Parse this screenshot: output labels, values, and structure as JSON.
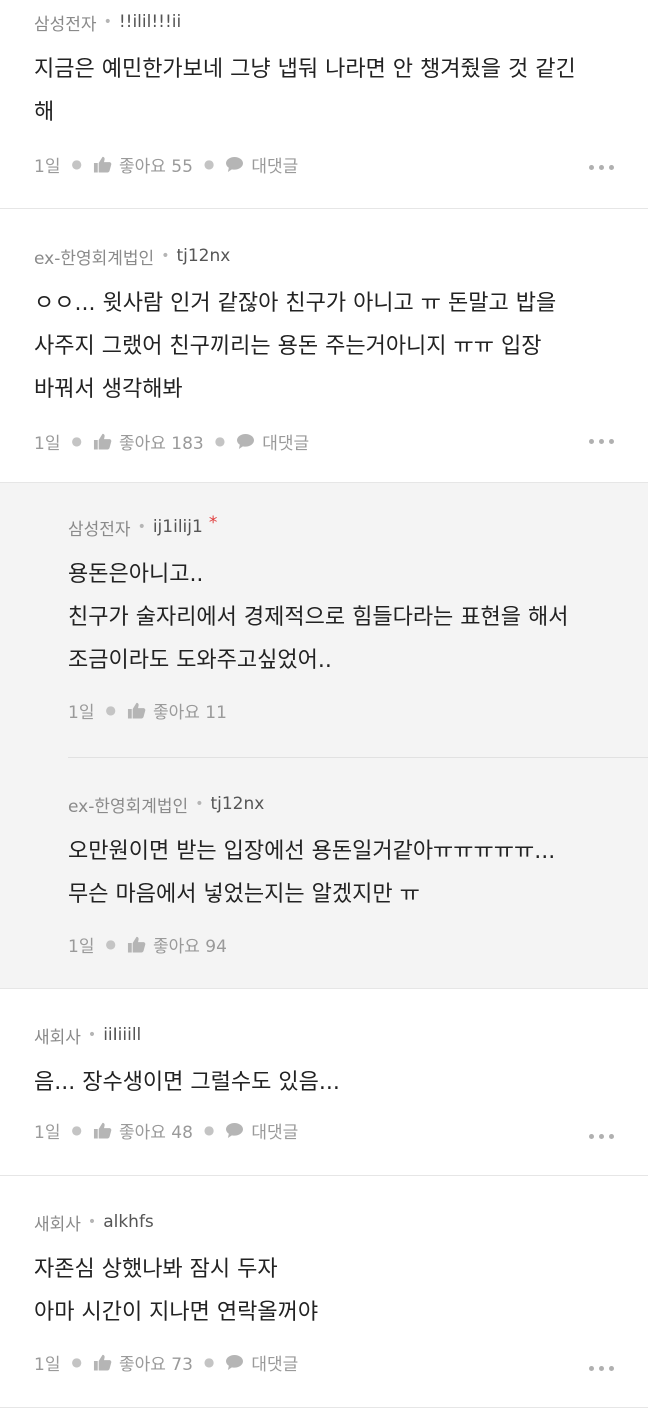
{
  "comments": [
    {
      "company": "삼성전자",
      "nickname": "!!ilil!!!ii",
      "lines": [
        "지금은 예민한가보네 그냥 냅둬 나라면 안 챙겨줬을 것 같긴",
        "해"
      ],
      "time": "1일",
      "like_label": "좋아요 55",
      "reply_label": "대댓글"
    },
    {
      "company": "ex-한영회계법인",
      "nickname": "tj12nx",
      "lines": [
        "ㅇㅇ... 윗사람 인거 같잖아 친구가 아니고 ㅠ 돈말고 밥을",
        "사주지 그랬어 친구끼리는 용돈 주는거아니지  ㅠㅠ  입장",
        "바꿔서 생각해봐"
      ],
      "time": "1일",
      "like_label": "좋아요 183",
      "reply_label": "대댓글"
    },
    {
      "company": "새회사",
      "nickname": "iiIiiill",
      "lines": [
        "음... 장수생이면 그럴수도 있음..."
      ],
      "time": "1일",
      "like_label": "좋아요 48",
      "reply_label": "대댓글"
    },
    {
      "company": "새회사",
      "nickname": "alkhfs",
      "lines": [
        "자존심 상했나봐 잠시 두자",
        "아마 시간이 지나면 연락올꺼야"
      ],
      "time": "1일",
      "like_label": "좋아요 73",
      "reply_label": "대댓글"
    }
  ],
  "replies": [
    {
      "company": "삼성전자",
      "nickname": "ij1ilij1",
      "author_mark": "*",
      "lines": [
        "용돈은아니고..",
        "친구가 술자리에서 경제적으로 힘들다라는 표현을 해서",
        "조금이라도 도와주고싶었어.."
      ],
      "time": "1일",
      "like_label": "좋아요 11"
    },
    {
      "company": "ex-한영회계법인",
      "nickname": "tj12nx",
      "lines": [
        "오만원이면 받는 입장에선 용돈일거같아ㅠㅠㅠㅠㅠ...",
        "무슨 마음에서 넣었는지는 알겠지만 ㅠ"
      ],
      "time": "1일",
      "like_label": "좋아요 94"
    }
  ],
  "icons": {
    "like": "thumbs-up-icon",
    "reply": "speech-bubble-icon",
    "more": "more-dots-icon"
  },
  "colors": {
    "meta": "#8a8a8a",
    "accent_mark": "#e03b3b",
    "reply_bg": "#f4f4f4",
    "divider": "#e6e6e6"
  }
}
